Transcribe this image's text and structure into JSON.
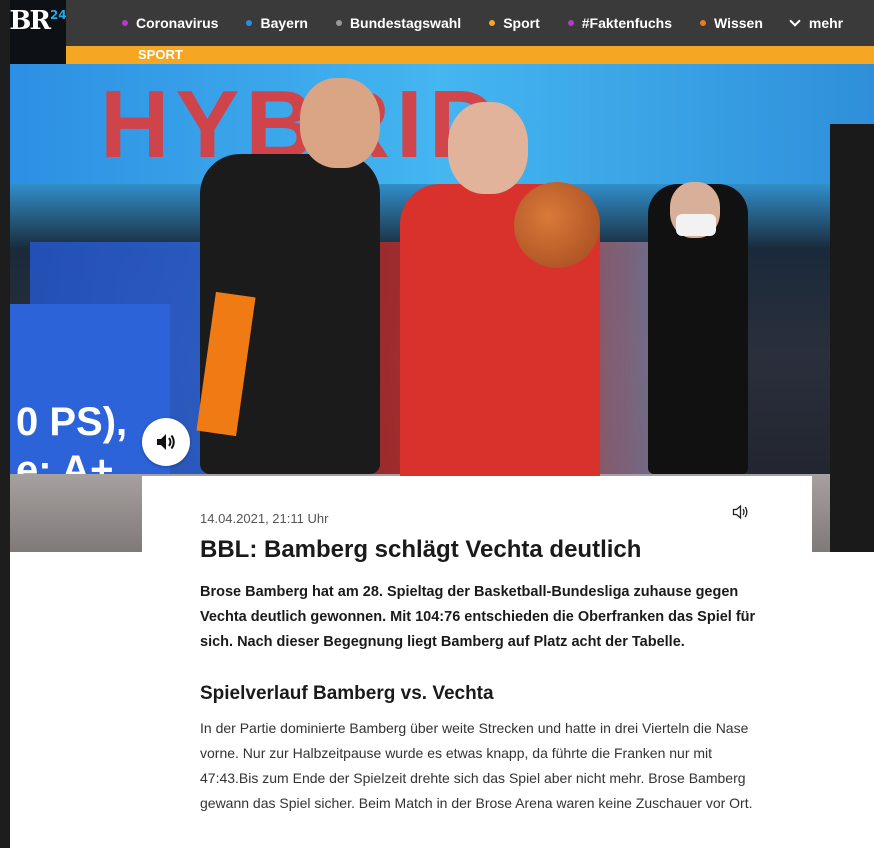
{
  "brand": {
    "logo_text": "BR",
    "logo_badge": "24",
    "badge_color": "#2aa9e0"
  },
  "nav": {
    "items": [
      {
        "label": "Coronavirus",
        "dot_color": "#b23cc9"
      },
      {
        "label": "Bayern",
        "dot_color": "#2a8fd6"
      },
      {
        "label": "Bundestagswahl",
        "dot_color": "#9a9a9a"
      },
      {
        "label": "Sport",
        "dot_color": "#f5a623"
      },
      {
        "label": "#Faktenfuchs",
        "dot_color": "#b23cc9"
      },
      {
        "label": "Wissen",
        "dot_color": "#f07a14"
      }
    ],
    "more_label": "mehr"
  },
  "section": {
    "label": "SPORT",
    "color": "#f5a623"
  },
  "hero": {
    "board_text": "HYBRID",
    "screen_line1": "0 PS),",
    "screen_line2": "e: A+",
    "audio_icon": "speaker-icon"
  },
  "article": {
    "date": "14.04.2021, 21:11 Uhr",
    "headline": "BBL: Bamberg schlägt Vechta deutlich",
    "lead": "Brose Bamberg hat am 28. Spieltag der Basketball-Bundesliga zuhause gegen Vechta deutlich gewonnen. Mit 104:76 entschieden die Oberfranken das Spiel für sich. Nach dieser Begegnung liegt Bamberg auf Platz acht der Tabelle.",
    "subheading": "Spielverlauf Bamberg vs. Vechta",
    "body": "In der Partie dominierte Bamberg über weite Strecken und hatte in drei Vierteln die Nase vorne. Nur zur Halbzeitpause wurde es etwas knapp, da führte die Franken nur mit 47:43.Bis zum Ende der Spielzeit drehte sich das Spiel aber nicht mehr. Brose Bamberg gewann das Spiel sicher. Beim Match in der Brose Arena waren keine Zuschauer vor Ort."
  }
}
